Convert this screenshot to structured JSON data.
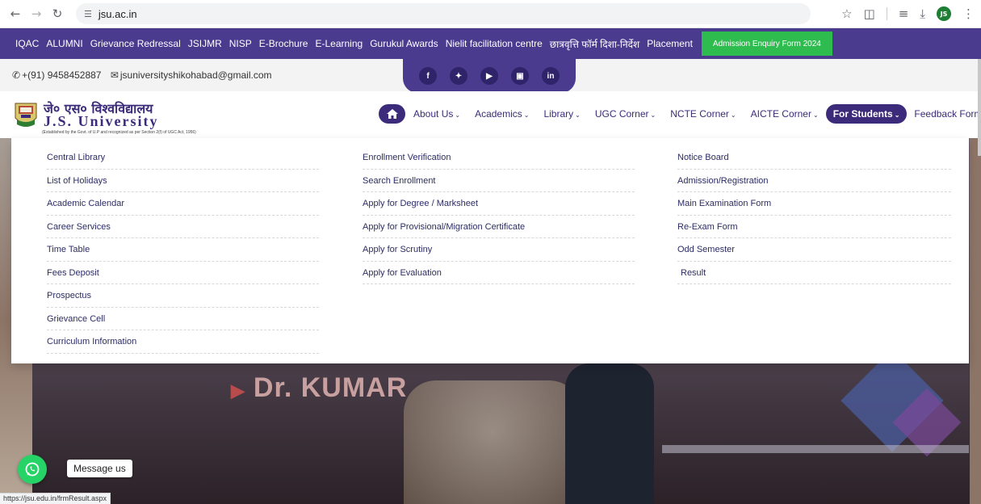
{
  "browser": {
    "url": "jsu.ac.in",
    "status_url": "https://jsu.edu.in/frmResult.aspx",
    "avatar_initials": "JS"
  },
  "topbar": {
    "links": [
      "IQAC",
      "ALUMNI",
      "Grievance Redressal",
      "JSIJMR",
      "NISP",
      "E-Brochure",
      "E-Learning",
      "Gurukul Awards",
      "Nielit facilitation centre",
      "छात्रवृत्ति फॉर्म दिशा-निर्देश",
      "Placement"
    ],
    "admission_button": "Admission Enquiry Form 2024",
    "bg_color": "#4a3b8f",
    "button_color": "#2ebc4f"
  },
  "contact": {
    "phone": "+(91) 9458452887",
    "email": "jsuniversityshikohabad@gmail.com"
  },
  "social": [
    "f",
    "t",
    "yt",
    "ig",
    "in"
  ],
  "logo": {
    "hindi": "जे० एस० विश्वविद्यालय",
    "english": "J.S. University",
    "subtitle": "(Established by the Govt. of U.P and recognized as per Section 2(f) of UGC Act, 1956)"
  },
  "nav": {
    "items": [
      "About Us",
      "Academics",
      "Library",
      "UGC Corner",
      "NCTE Corner",
      "AICTE Corner",
      "For Students",
      "Feedback Form"
    ],
    "active": "For Students",
    "accent": "#3b2b7a"
  },
  "menu": {
    "col1": [
      "Central Library",
      "List of Holidays",
      "Academic Calendar",
      "Career Services",
      "Time Table",
      "Fees Deposit",
      "Prospectus",
      "Grievance Cell",
      "Curriculum Information"
    ],
    "col2": [
      "Enrollment Verification",
      "Search Enrollment",
      "Apply for Degree / Marksheet",
      "Apply for Provisional/Migration Certificate",
      "Apply for Scrutiny",
      "Apply for Evaluation"
    ],
    "col3": [
      "Notice Board",
      "Admission/Registration",
      "Main Examination Form",
      "Re-Exam Form",
      "Odd Semester",
      "Result"
    ]
  },
  "hero": {
    "banner_text": "Dr. KUMAR"
  },
  "whatsapp": {
    "message": "Message us",
    "color": "#25d366"
  }
}
